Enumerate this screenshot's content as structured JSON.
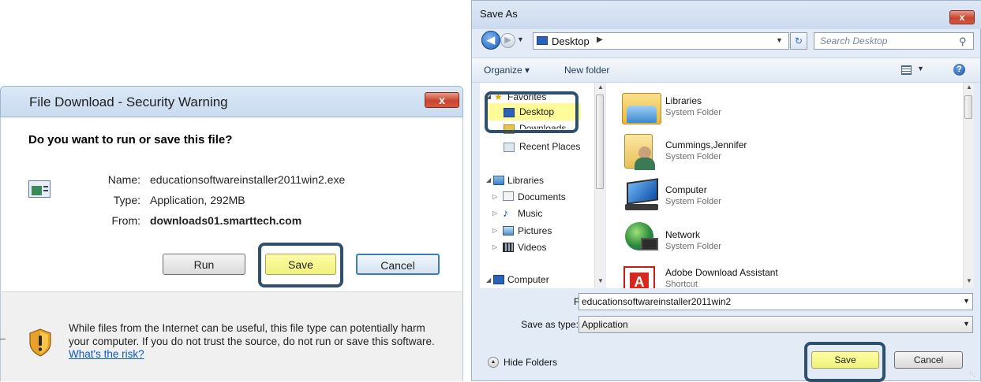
{
  "file_download": {
    "title": "File Download - Security Warning",
    "close": "x",
    "question": "Do you want to run or save this file?",
    "name_label": "Name:",
    "name_value": "educationsoftwareinstaller2011win2.exe",
    "type_label": "Type:",
    "type_value": "Application, 292MB",
    "from_label": "From:",
    "from_value": "downloads01.smarttech.com",
    "run_label": "Run",
    "save_label": "Save",
    "cancel_label": "Cancel",
    "warning_text": "While files from the Internet can be useful, this file type can potentially harm your computer. If you do not trust the source, do not run or save this software.",
    "risk_link": "What's the risk?",
    "file_icon": "application-file-icon",
    "shield_icon": "security-warning-shield-icon"
  },
  "save_as": {
    "title": "Save As",
    "close": "x",
    "address": "Desktop",
    "search_placeholder": "Search Desktop",
    "organize_label": "Organize ▾",
    "new_folder_label": "New folder",
    "help": "?",
    "nav": {
      "favorites": "Favorites",
      "desktop": "Desktop",
      "downloads": "Downloads",
      "recent": "Recent Places",
      "libraries": "Libraries",
      "documents": "Documents",
      "music": "Music",
      "pictures": "Pictures",
      "videos": "Videos",
      "computer": "Computer"
    },
    "items": [
      {
        "name": "Libraries",
        "sub": "System Folder",
        "icon": "libraries-folder-icon"
      },
      {
        "name": "Cummings,Jennifer",
        "sub": "System Folder",
        "icon": "user-folder-icon"
      },
      {
        "name": "Computer",
        "sub": "System Folder",
        "icon": "computer-icon"
      },
      {
        "name": "Network",
        "sub": "System Folder",
        "icon": "network-globe-icon"
      },
      {
        "name": "Adobe Download Assistant",
        "sub": "Shortcut",
        "icon": "adobe-icon"
      }
    ],
    "file_name_label": "File name:",
    "file_name_value": "educationsoftwareinstaller2011win2",
    "save_type_label": "Save as type:",
    "save_type_value": "Application",
    "hide_folders_label": "Hide Folders",
    "save_label": "Save",
    "cancel_label": "Cancel"
  },
  "colors": {
    "highlight_yellow": "#fffb98",
    "callout_border": "#2f4f6f",
    "link_blue": "#0a58c6"
  }
}
